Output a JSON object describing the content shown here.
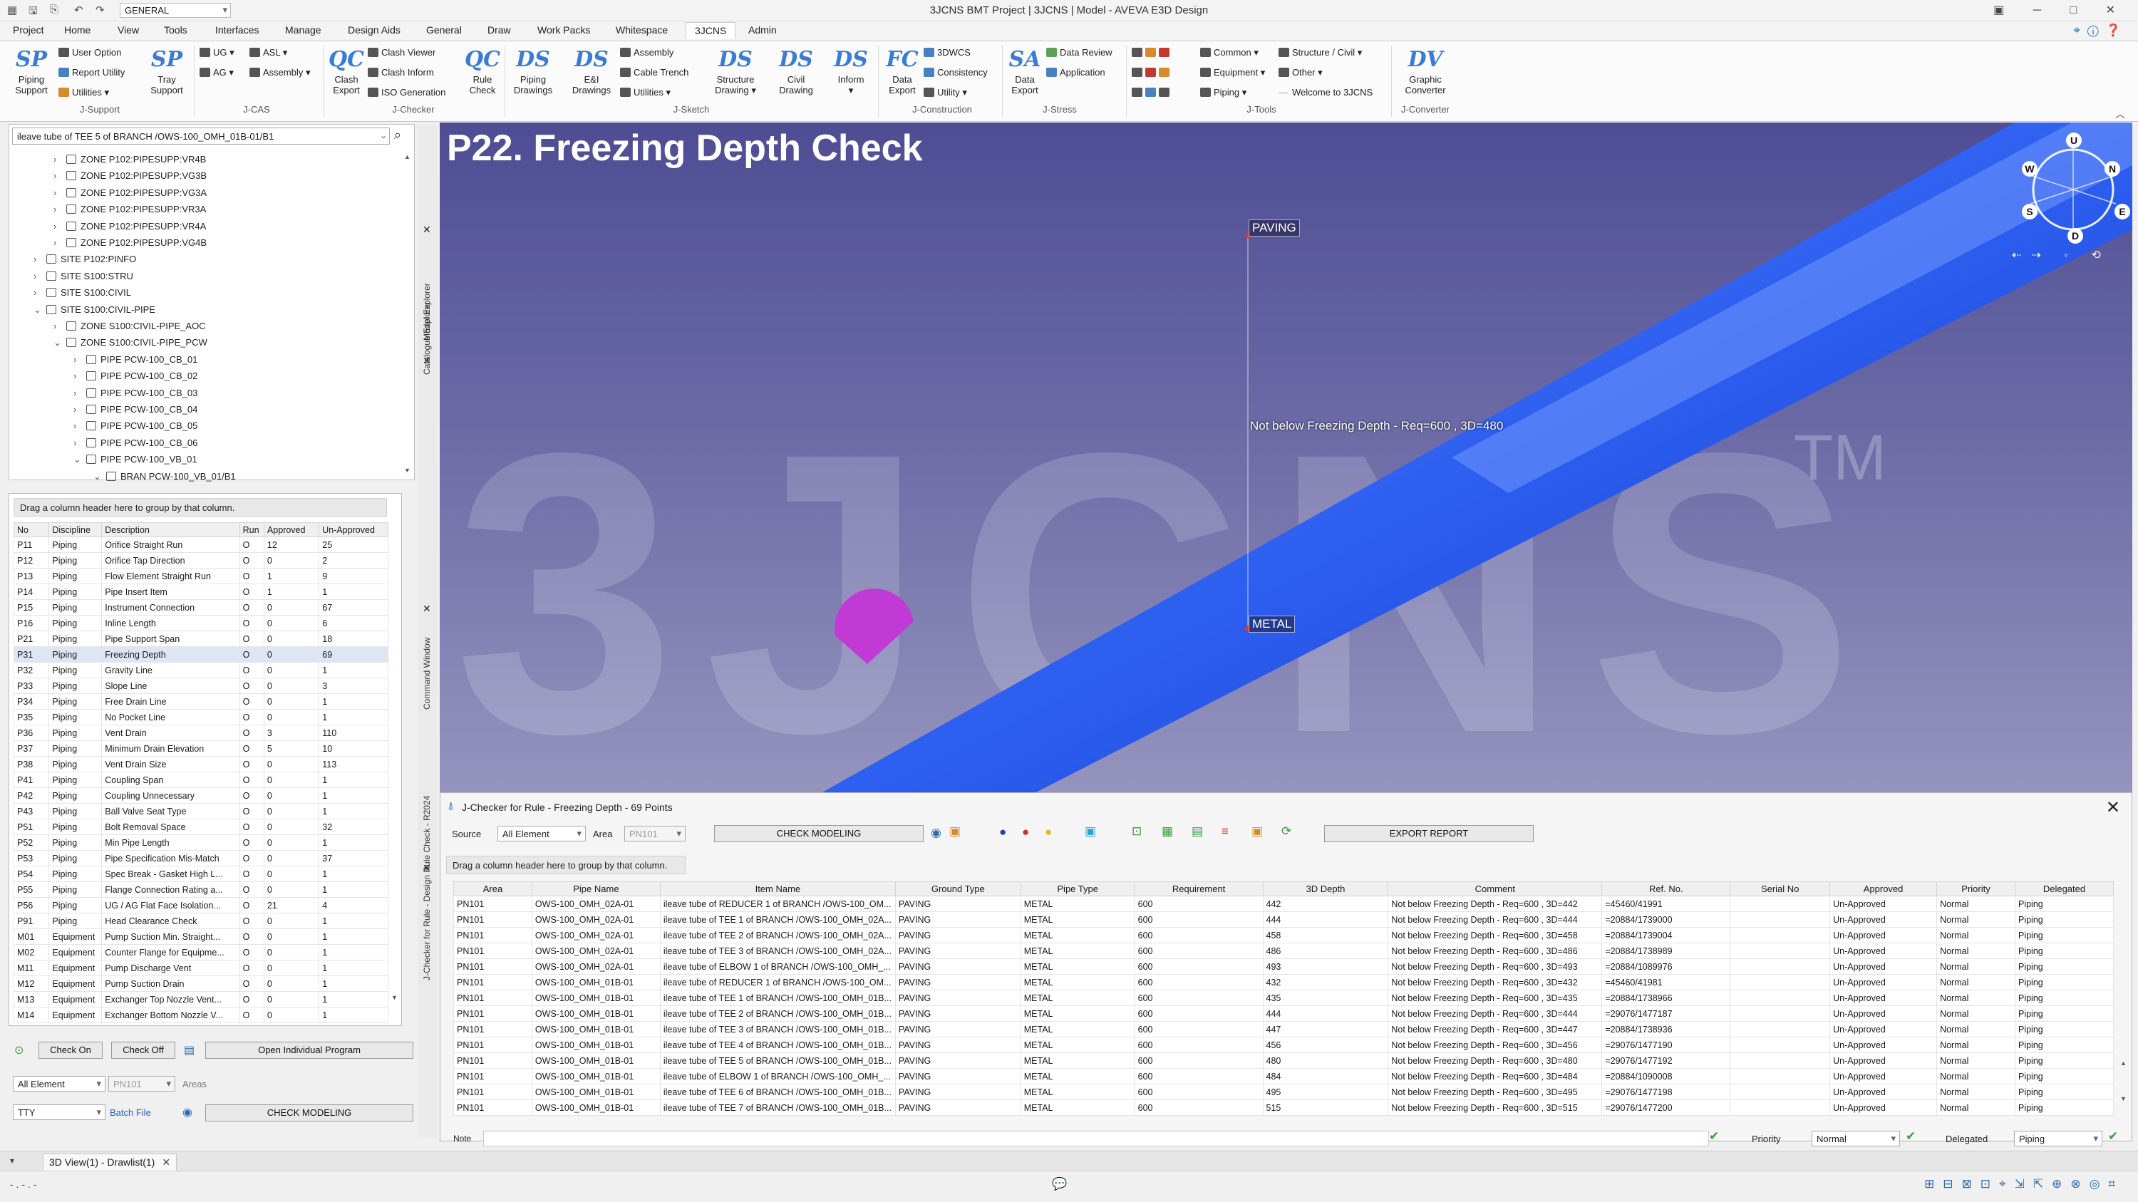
{
  "titlebar": {
    "workspace": "GENERAL",
    "window_title": "3JCNS BMT Project | 3JCNS | Model - AVEVA E3D Design",
    "controls": "▣ ─ □ ✕"
  },
  "menu": {
    "tabs": [
      "Project",
      "Home",
      "View",
      "Tools",
      "Interfaces",
      "Manage",
      "Design Aids",
      "General",
      "Draw",
      "Work Packs",
      "Whitespace",
      "3JCNS",
      "Admin"
    ],
    "active": "3JCNS"
  },
  "ribbon": {
    "j_support": {
      "group": "J-Support",
      "piping_support": "Piping\nSupport",
      "user_option": "User Option",
      "report_utility": "Report Utility",
      "utilities": "Utilities ▾",
      "tray_support": "Tray\nSupport"
    },
    "j_cas": {
      "group": "J-CAS",
      "ug": "UG ▾",
      "asl": "ASL ▾",
      "ag": "AG ▾",
      "assembly": "Assembly ▾"
    },
    "j_checker": {
      "group": "J-Checker",
      "clash_export": "Clash\nExport",
      "clash_viewer": "Clash Viewer",
      "clash_inform": "Clash Inform",
      "iso_generation": "ISO Generation",
      "rule_check": "Rule\nCheck"
    },
    "j_sketch": {
      "group": "J-Sketch",
      "piping_drawings": "Piping\nDrawings",
      "ei_drawings": "E&I\nDrawings",
      "assembly": "Assembly",
      "cable_trench": "Cable Trench",
      "utilities": "Utilities ▾",
      "structure_drawing": "Structure\nDrawing ▾",
      "civil_drawing": "Civil\nDrawing",
      "inform": "Inform\n▾"
    },
    "j_construction": {
      "group": "J-Construction",
      "data_export": "Data\nExport",
      "3dwcs": "3DWCS",
      "consistency": "Consistency",
      "utility": "Utility ▾"
    },
    "j_stress": {
      "group": "J-Stress",
      "data_export": "Data\nExport",
      "data_review": "Data Review",
      "application": "Application"
    },
    "j_tools": {
      "group": "J-Tools",
      "common": "Common ▾",
      "equipment": "Equipment ▾",
      "piping": "Piping ▾",
      "structure_civil": "Structure / Civil ▾",
      "other": "Other ▾",
      "welcome": "Welcome to 3JCNS"
    },
    "j_converter": {
      "group": "J-Converter",
      "graphic_converter": "Graphic\nConverter"
    }
  },
  "explorer": {
    "search_value": "ileave tube of TEE 5 of BRANCH /OWS-100_OMH_01B-01/B1",
    "rows": [
      {
        "label": "ZONE P102:PIPESUPP:VR4B",
        "indent": 2,
        "exp": "›"
      },
      {
        "label": "ZONE P102:PIPESUPP:VG3B",
        "indent": 2,
        "exp": "›"
      },
      {
        "label": "ZONE P102:PIPESUPP:VG3A",
        "indent": 2,
        "exp": "›"
      },
      {
        "label": "ZONE P102:PIPESUPP:VR3A",
        "indent": 2,
        "exp": "›"
      },
      {
        "label": "ZONE P102:PIPESUPP:VR4A",
        "indent": 2,
        "exp": "›"
      },
      {
        "label": "ZONE P102:PIPESUPP:VG4B",
        "indent": 2,
        "exp": "›"
      },
      {
        "label": "SITE P102:PINFO",
        "indent": 1,
        "exp": "›"
      },
      {
        "label": "SITE S100:STRU",
        "indent": 1,
        "exp": "›"
      },
      {
        "label": "SITE S100:CIVIL",
        "indent": 1,
        "exp": "›"
      },
      {
        "label": "SITE S100:CIVIL-PIPE",
        "indent": 1,
        "exp": "⌄"
      },
      {
        "label": "ZONE S100:CIVIL-PIPE_AOC",
        "indent": 2,
        "exp": "›"
      },
      {
        "label": "ZONE S100:CIVIL-PIPE_PCW",
        "indent": 2,
        "exp": "⌄"
      },
      {
        "label": "PIPE PCW-100_CB_01",
        "indent": 3,
        "exp": "›"
      },
      {
        "label": "PIPE PCW-100_CB_02",
        "indent": 3,
        "exp": "›"
      },
      {
        "label": "PIPE PCW-100_CB_03",
        "indent": 3,
        "exp": "›"
      },
      {
        "label": "PIPE PCW-100_CB_04",
        "indent": 3,
        "exp": "›"
      },
      {
        "label": "PIPE PCW-100_CB_05",
        "indent": 3,
        "exp": "›"
      },
      {
        "label": "PIPE PCW-100_CB_06",
        "indent": 3,
        "exp": "›"
      },
      {
        "label": "PIPE PCW-100_VB_01",
        "indent": 3,
        "exp": "⌄"
      },
      {
        "label": "BRAN PCW-100_VB_01/B1",
        "indent": 4,
        "exp": "⌄"
      }
    ]
  },
  "side_tabs": {
    "model_explorer": "Model Explorer",
    "catalogue_explorer": "Catalogue Explorer",
    "command_window": "Command Window",
    "jchecker_rule": "J-Checker for Rule - Design Rule Check - R2024"
  },
  "rules": {
    "group_hint": "Drag a column header here to group by that column.",
    "headers": [
      "No",
      "Discipline",
      "Description",
      "Run",
      "Approved",
      "Un-Approved"
    ],
    "rows": [
      [
        "P11",
        "Piping",
        "Orifice Straight Run",
        "O",
        "12",
        "25"
      ],
      [
        "P12",
        "Piping",
        "Orifice Tap Direction",
        "O",
        "0",
        "2"
      ],
      [
        "P13",
        "Piping",
        "Flow Element Straight Run",
        "O",
        "1",
        "9"
      ],
      [
        "P14",
        "Piping",
        "Pipe Insert Item",
        "O",
        "1",
        "1"
      ],
      [
        "P15",
        "Piping",
        "Instrument Connection",
        "O",
        "0",
        "67"
      ],
      [
        "P16",
        "Piping",
        "Inline Length",
        "O",
        "0",
        "6"
      ],
      [
        "P21",
        "Piping",
        "Pipe Support Span",
        "O",
        "0",
        "18"
      ],
      [
        "P31",
        "Piping",
        "Freezing Depth",
        "O",
        "0",
        "69"
      ],
      [
        "P32",
        "Piping",
        "Gravity Line",
        "O",
        "0",
        "1"
      ],
      [
        "P33",
        "Piping",
        "Slope Line",
        "O",
        "0",
        "3"
      ],
      [
        "P34",
        "Piping",
        "Free Drain Line",
        "O",
        "0",
        "1"
      ],
      [
        "P35",
        "Piping",
        "No Pocket Line",
        "O",
        "0",
        "1"
      ],
      [
        "P36",
        "Piping",
        "Vent Drain",
        "O",
        "3",
        "110"
      ],
      [
        "P37",
        "Piping",
        "Minimum Drain Elevation",
        "O",
        "5",
        "10"
      ],
      [
        "P38",
        "Piping",
        "Vent Drain Size",
        "O",
        "0",
        "113"
      ],
      [
        "P41",
        "Piping",
        "Coupling Span",
        "O",
        "0",
        "1"
      ],
      [
        "P42",
        "Piping",
        "Coupling Unnecessary",
        "O",
        "0",
        "1"
      ],
      [
        "P43",
        "Piping",
        "Ball Valve Seat Type",
        "O",
        "0",
        "1"
      ],
      [
        "P51",
        "Piping",
        "Bolt Removal Space",
        "O",
        "0",
        "32"
      ],
      [
        "P52",
        "Piping",
        "Min Pipe Length",
        "O",
        "0",
        "1"
      ],
      [
        "P53",
        "Piping",
        "Pipe Specification Mis-Match",
        "O",
        "0",
        "37"
      ],
      [
        "P54",
        "Piping",
        "Spec Break - Gasket High L...",
        "O",
        "0",
        "1"
      ],
      [
        "P55",
        "Piping",
        "Flange Connection Rating a...",
        "O",
        "0",
        "1"
      ],
      [
        "P56",
        "Piping",
        "UG / AG Flat Face Isolation...",
        "O",
        "21",
        "4"
      ],
      [
        "P91",
        "Piping",
        "Head Clearance Check",
        "O",
        "0",
        "1"
      ],
      [
        "M01",
        "Equipment",
        "Pump Suction Min. Straight...",
        "O",
        "0",
        "1"
      ],
      [
        "M02",
        "Equipment",
        "Counter Flange for Equipme...",
        "O",
        "0",
        "1"
      ],
      [
        "M11",
        "Equipment",
        "Pump Discharge Vent",
        "O",
        "0",
        "1"
      ],
      [
        "M12",
        "Equipment",
        "Pump Suction Drain",
        "O",
        "0",
        "1"
      ],
      [
        "M13",
        "Equipment",
        "Exchanger Top Nozzle Vent...",
        "O",
        "0",
        "1"
      ],
      [
        "M14",
        "Equipment",
        "Exchanger Bottom Nozzle V...",
        "O",
        "0",
        "1"
      ]
    ],
    "selected_index": 7,
    "check_on": "Check On",
    "check_off": "Check Off",
    "open_individual": "Open Individual Program",
    "source_value": "All Element",
    "area_value": "PN101",
    "areas_label": "Areas",
    "tty_value": "TTY",
    "batch_file": "Batch File",
    "check_modeling": "CHECK MODELING"
  },
  "viewport": {
    "title": "P22. Freezing Depth Check",
    "watermark": "3JCNS",
    "tm": "TM",
    "paving_tag": "PAVING",
    "metal_tag": "METAL",
    "annotation": "Not below Freezing Depth - Req=600 , 3D=480",
    "compass": {
      "up": "U",
      "down": "D",
      "n": "N",
      "s": "S",
      "e": "E",
      "w": "W"
    }
  },
  "checker": {
    "title": "J-Checker for Rule - Freezing Depth - 69 Points",
    "source_label": "Source",
    "source_value": "All Element",
    "area_label": "Area",
    "area_value": "PN101",
    "check_modeling": "CHECK MODELING",
    "export_report": "EXPORT REPORT",
    "group_hint": "Drag a column header here to group by that column.",
    "headers": [
      "Area",
      "Pipe Name",
      "Item Name",
      "Ground Type",
      "Pipe Type",
      "Requirement",
      "3D Depth",
      "Comment",
      "Ref. No.",
      "Serial No",
      "Approved",
      "Priority",
      "Delegated"
    ],
    "rows": [
      [
        "PN101",
        "OWS-100_OMH_02A-01",
        "ileave tube of REDUCER 1 of BRANCH /OWS-100_OM...",
        "PAVING",
        "METAL",
        "600",
        "442",
        "Not below Freezing Depth - Req=600 , 3D=442",
        "=45460/41991",
        "",
        "Un-Approved",
        "Normal",
        "Piping"
      ],
      [
        "PN101",
        "OWS-100_OMH_02A-01",
        "ileave tube of TEE 1 of BRANCH /OWS-100_OMH_02A...",
        "PAVING",
        "METAL",
        "600",
        "444",
        "Not below Freezing Depth - Req=600 , 3D=444",
        "=20884/1739000",
        "",
        "Un-Approved",
        "Normal",
        "Piping"
      ],
      [
        "PN101",
        "OWS-100_OMH_02A-01",
        "ileave tube of TEE 2 of BRANCH /OWS-100_OMH_02A...",
        "PAVING",
        "METAL",
        "600",
        "458",
        "Not below Freezing Depth - Req=600 , 3D=458",
        "=20884/1739004",
        "",
        "Un-Approved",
        "Normal",
        "Piping"
      ],
      [
        "PN101",
        "OWS-100_OMH_02A-01",
        "ileave tube of TEE 3 of BRANCH /OWS-100_OMH_02A...",
        "PAVING",
        "METAL",
        "600",
        "486",
        "Not below Freezing Depth - Req=600 , 3D=486",
        "=20884/1738989",
        "",
        "Un-Approved",
        "Normal",
        "Piping"
      ],
      [
        "PN101",
        "OWS-100_OMH_02A-01",
        "ileave tube of ELBOW 1 of BRANCH /OWS-100_OMH_...",
        "PAVING",
        "METAL",
        "600",
        "493",
        "Not below Freezing Depth - Req=600 , 3D=493",
        "=20884/1089976",
        "",
        "Un-Approved",
        "Normal",
        "Piping"
      ],
      [
        "PN101",
        "OWS-100_OMH_01B-01",
        "ileave tube of REDUCER 1 of BRANCH /OWS-100_OM...",
        "PAVING",
        "METAL",
        "600",
        "432",
        "Not below Freezing Depth - Req=600 , 3D=432",
        "=45460/41981",
        "",
        "Un-Approved",
        "Normal",
        "Piping"
      ],
      [
        "PN101",
        "OWS-100_OMH_01B-01",
        "ileave tube of TEE 1 of BRANCH /OWS-100_OMH_01B...",
        "PAVING",
        "METAL",
        "600",
        "435",
        "Not below Freezing Depth - Req=600 , 3D=435",
        "=20884/1738966",
        "",
        "Un-Approved",
        "Normal",
        "Piping"
      ],
      [
        "PN101",
        "OWS-100_OMH_01B-01",
        "ileave tube of TEE 2 of BRANCH /OWS-100_OMH_01B...",
        "PAVING",
        "METAL",
        "600",
        "444",
        "Not below Freezing Depth - Req=600 , 3D=444",
        "=29076/1477187",
        "",
        "Un-Approved",
        "Normal",
        "Piping"
      ],
      [
        "PN101",
        "OWS-100_OMH_01B-01",
        "ileave tube of TEE 3 of BRANCH /OWS-100_OMH_01B...",
        "PAVING",
        "METAL",
        "600",
        "447",
        "Not below Freezing Depth - Req=600 , 3D=447",
        "=20884/1738936",
        "",
        "Un-Approved",
        "Normal",
        "Piping"
      ],
      [
        "PN101",
        "OWS-100_OMH_01B-01",
        "ileave tube of TEE 4 of BRANCH /OWS-100_OMH_01B...",
        "PAVING",
        "METAL",
        "600",
        "456",
        "Not below Freezing Depth - Req=600 , 3D=456",
        "=29076/1477190",
        "",
        "Un-Approved",
        "Normal",
        "Piping"
      ],
      [
        "PN101",
        "OWS-100_OMH_01B-01",
        "ileave tube of TEE 5 of BRANCH /OWS-100_OMH_01B...",
        "PAVING",
        "METAL",
        "600",
        "480",
        "Not below Freezing Depth - Req=600 , 3D=480",
        "=29076/1477192",
        "",
        "Un-Approved",
        "Normal",
        "Piping"
      ],
      [
        "PN101",
        "OWS-100_OMH_01B-01",
        "ileave tube of ELBOW 1 of BRANCH /OWS-100_OMH_...",
        "PAVING",
        "METAL",
        "600",
        "484",
        "Not below Freezing Depth - Req=600 , 3D=484",
        "=20884/1090008",
        "",
        "Un-Approved",
        "Normal",
        "Piping"
      ],
      [
        "PN101",
        "OWS-100_OMH_01B-01",
        "ileave tube of TEE 6 of BRANCH /OWS-100_OMH_01B...",
        "PAVING",
        "METAL",
        "600",
        "495",
        "Not below Freezing Depth - Req=600 , 3D=495",
        "=29076/1477198",
        "",
        "Un-Approved",
        "Normal",
        "Piping"
      ],
      [
        "PN101",
        "OWS-100_OMH_01B-01",
        "ileave tube of TEE 7 of BRANCH /OWS-100_OMH_01B...",
        "PAVING",
        "METAL",
        "600",
        "515",
        "Not below Freezing Depth - Req=600 , 3D=515",
        "=29076/1477200",
        "",
        "Un-Approved",
        "Normal",
        "Piping"
      ]
    ],
    "selected_index": 10,
    "note_label": "Note",
    "priority_label": "Priority",
    "priority_value": "Normal",
    "delegated_label": "Delegated",
    "delegated_value": "Piping"
  },
  "doc_tab": "3D View(1) - Drawlist(1)",
  "status_text": "- . - . -"
}
